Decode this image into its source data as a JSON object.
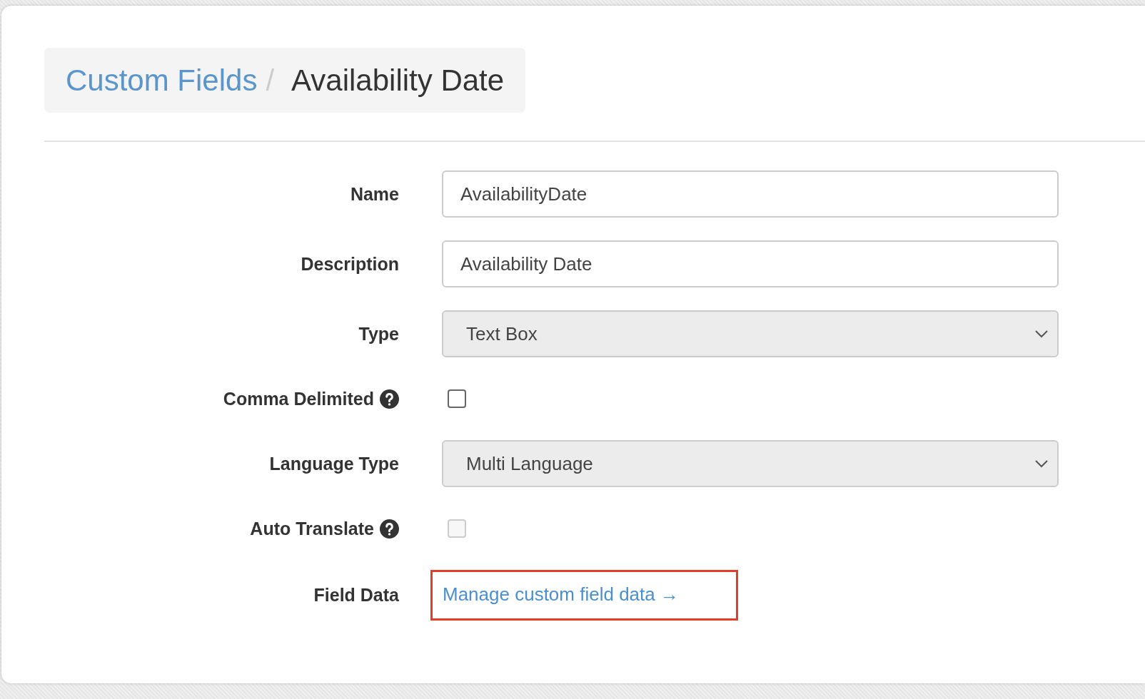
{
  "breadcrumb": {
    "parent": "Custom Fields",
    "separator": "/",
    "current": "Availability Date"
  },
  "form": [
    {
      "kind": "text",
      "label": "Name",
      "help": false,
      "value": "AvailabilityDate"
    },
    {
      "kind": "text",
      "label": "Description",
      "help": false,
      "value": "Availability Date"
    },
    {
      "kind": "select",
      "label": "Type",
      "help": false,
      "value": "Text Box"
    },
    {
      "kind": "checkbox",
      "label": "Comma Delimited",
      "help": true,
      "checked": false,
      "disabled": false
    },
    {
      "kind": "select",
      "label": "Language Type",
      "help": false,
      "value": "Multi Language"
    },
    {
      "kind": "checkbox",
      "label": "Auto Translate",
      "help": true,
      "checked": false,
      "disabled": true
    },
    {
      "kind": "link",
      "label": "Field Data",
      "help": false,
      "text": "Manage custom field data →",
      "highlighted": true
    }
  ]
}
